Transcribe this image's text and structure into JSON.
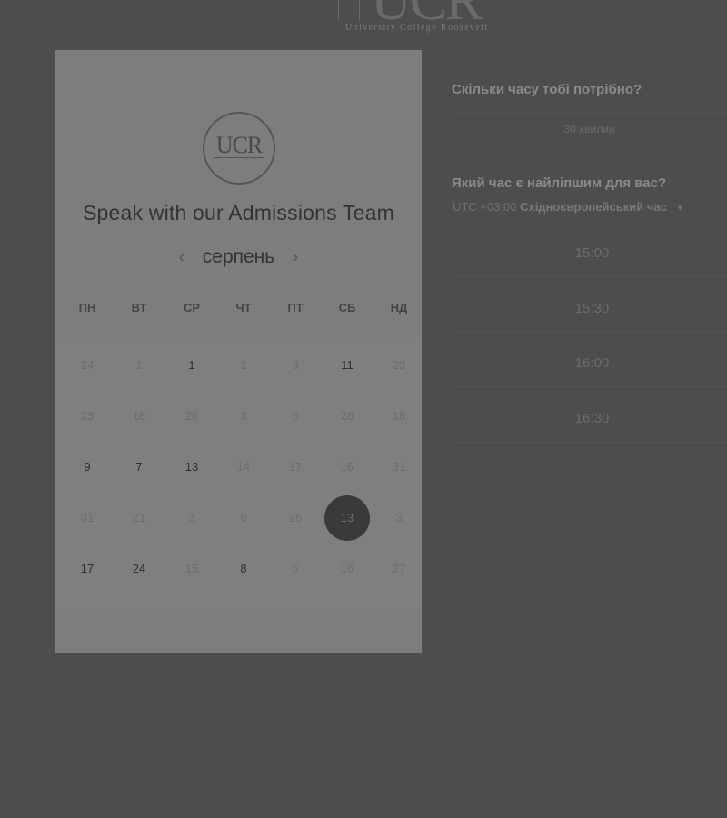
{
  "top_logo": {
    "text": "UCR",
    "subtitle": "University College Roosevelt"
  },
  "card": {
    "logo_text": "UCR",
    "title": "Speak with our Admissions Team",
    "month": "серпень",
    "prev_icon": "chevron-left-icon",
    "next_icon": "chevron-right-icon",
    "weekdays": [
      "ПН",
      "ВТ",
      "СР",
      "ЧТ",
      "ПТ",
      "СБ",
      "НД"
    ],
    "weeks": [
      [
        {
          "d": "24",
          "on": false
        },
        {
          "d": "1",
          "on": false
        },
        {
          "d": "1",
          "on": true
        },
        {
          "d": "2",
          "on": false
        },
        {
          "d": "3",
          "on": false
        },
        {
          "d": "11",
          "on": true
        },
        {
          "d": "23",
          "on": false
        }
      ],
      [
        {
          "d": "23",
          "on": false
        },
        {
          "d": "18",
          "on": false
        },
        {
          "d": "20",
          "on": false
        },
        {
          "d": "3",
          "on": false
        },
        {
          "d": "5",
          "on": false
        },
        {
          "d": "26",
          "on": false
        },
        {
          "d": "18",
          "on": false
        }
      ],
      [
        {
          "d": "9",
          "on": true
        },
        {
          "d": "7",
          "on": true
        },
        {
          "d": "13",
          "on": true
        },
        {
          "d": "14",
          "on": false
        },
        {
          "d": "17",
          "on": false
        },
        {
          "d": "16",
          "on": false
        },
        {
          "d": "31",
          "on": false
        }
      ],
      [
        {
          "d": "31",
          "on": false
        },
        {
          "d": "21",
          "on": false
        },
        {
          "d": "3",
          "on": false
        },
        {
          "d": "6",
          "on": false
        },
        {
          "d": "26",
          "on": false
        },
        {
          "d": "13",
          "on": true,
          "selected": true
        },
        {
          "d": "3",
          "on": false
        }
      ],
      [
        {
          "d": "17",
          "on": true
        },
        {
          "d": "24",
          "on": true
        },
        {
          "d": "15",
          "on": false
        },
        {
          "d": "8",
          "on": true
        },
        {
          "d": "5",
          "on": false
        },
        {
          "d": "16",
          "on": false
        },
        {
          "d": "27",
          "on": false
        }
      ]
    ]
  },
  "scheduler": {
    "duration_question": "Скільки часу тобі потрібно?",
    "duration_value": "30 хвилин",
    "time_question": "Який час є найліпшим для вас?",
    "timezone_offset": "UTC +03:00",
    "timezone_name": "Східноєвропейський час",
    "slots": [
      "15:00",
      "15:30",
      "16:00",
      "16:30"
    ]
  },
  "colors": {
    "background": "#4d4d4d",
    "card": "#7d7d7d",
    "selected_day": "#3a3a3a"
  }
}
